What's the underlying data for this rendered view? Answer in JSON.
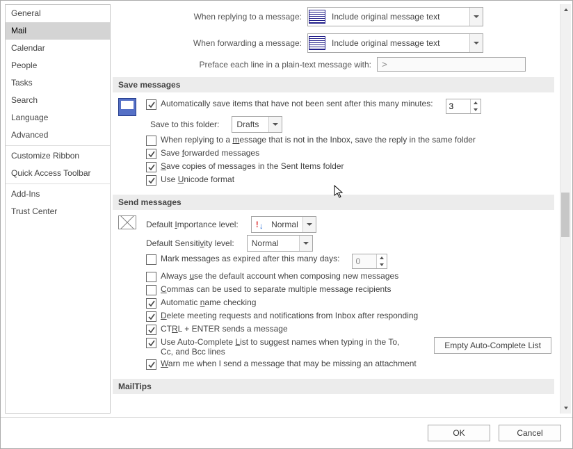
{
  "sidebar": {
    "items": [
      {
        "label": "General",
        "selected": false
      },
      {
        "label": "Mail",
        "selected": true
      },
      {
        "label": "Calendar",
        "selected": false
      },
      {
        "label": "People",
        "selected": false
      },
      {
        "label": "Tasks",
        "selected": false
      },
      {
        "label": "Search",
        "selected": false
      },
      {
        "label": "Language",
        "selected": false
      },
      {
        "label": "Advanced",
        "selected": false
      }
    ],
    "items2": [
      {
        "label": "Customize Ribbon"
      },
      {
        "label": "Quick Access Toolbar"
      }
    ],
    "items3": [
      {
        "label": "Add-Ins"
      },
      {
        "label": "Trust Center"
      }
    ]
  },
  "replies": {
    "reply_label": "When replying to a message:",
    "reply_value": "Include original message text",
    "fwd_label": "When forwarding a message:",
    "fwd_value": "Include original message text",
    "preface_label": "Preface each line in a plain-text message with:",
    "preface_value": ">"
  },
  "save": {
    "header": "Save messages",
    "autosave": "Automatically save items that have not been sent after this many minutes:",
    "autosave_val": "3",
    "folder_label": "Save to this folder:",
    "folder_value": "Drafts",
    "same_folder_pref": "When replying to a ",
    "same_folder_u": "m",
    "same_folder_suf": "essage that is not in the Inbox, save the reply in the same folder",
    "fwd_pref": "Save ",
    "fwd_u": "f",
    "fwd_suf": "orwarded messages",
    "sent_pref": "",
    "sent_u": "S",
    "sent_suf": "ave copies of messages in the Sent Items folder",
    "uni_pref": "Use ",
    "uni_u": "U",
    "uni_suf": "nicode format"
  },
  "send": {
    "header": "Send messages",
    "imp_pref": "Default ",
    "imp_u": "I",
    "imp_suf": "mportance level:",
    "imp_value": "Normal",
    "sens_pref": "Default Sensiti",
    "sens_u": "v",
    "sens_suf": "ity level:",
    "sens_value": "Normal",
    "expire": "Mark messages as expired after this many days:",
    "expire_val": "0",
    "default_acct_pref": "Always ",
    "default_acct_u": "u",
    "default_acct_suf": "se the default account when composing new messages",
    "commas_pref": "",
    "commas_u": "C",
    "commas_suf": "ommas can be used to separate multiple message recipients",
    "autoname_pref": "Automatic ",
    "autoname_u": "n",
    "autoname_suf": "ame checking",
    "delreq_pref": "",
    "delreq_u": "D",
    "delreq_suf": "elete meeting requests and notifications from Inbox after responding",
    "ctrlenter_pref": "CT",
    "ctrlenter_u": "R",
    "ctrlenter_suf": "L + ENTER sends a message",
    "ac_pref": "Use Auto-Complete ",
    "ac_u": "L",
    "ac_suf": "ist to suggest names when typing in the To, Cc, and Bcc lines",
    "empty_btn": "Empty Auto-Complete List",
    "warn_pref": "",
    "warn_u": "W",
    "warn_suf": "arn me when I send a message that may be missing an attachment"
  },
  "mailtips": {
    "header": "MailTips"
  },
  "buttons": {
    "ok": "OK",
    "cancel": "Cancel"
  }
}
